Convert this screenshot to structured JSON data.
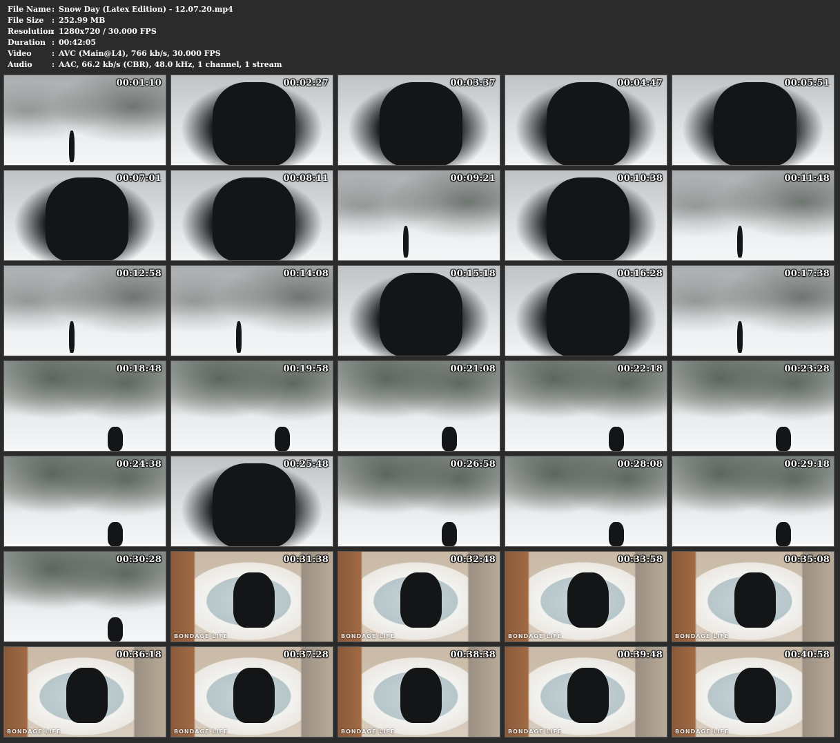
{
  "info": [
    {
      "key": "File Name",
      "sep": ":",
      "value": "Snow Day (Latex Edition) - 12.07.20.mp4"
    },
    {
      "key": "File Size",
      "sep": ":",
      "value": "252.99 MB"
    },
    {
      "key": "Resolution",
      "sep": ":",
      "value": "1280x720 / 30.000 FPS"
    },
    {
      "key": "Duration",
      "sep": ":",
      "value": "00:42:05"
    },
    {
      "key": "Video",
      "sep": ":",
      "value": "AVC (Main@L4), 766 kb/s, 30.000 FPS"
    },
    {
      "key": "Audio",
      "sep": ":",
      "value": "AAC, 66.2 kb/s (CBR), 48.0 kHz, 1 channel, 1 stream"
    }
  ],
  "thumbnails": [
    {
      "time": "00:01:10",
      "scene": "snow"
    },
    {
      "time": "00:02:27",
      "scene": "close"
    },
    {
      "time": "00:03:37",
      "scene": "close"
    },
    {
      "time": "00:04:47",
      "scene": "close"
    },
    {
      "time": "00:05:51",
      "scene": "close"
    },
    {
      "time": "00:07:01",
      "scene": "close"
    },
    {
      "time": "00:08:11",
      "scene": "close"
    },
    {
      "time": "00:09:21",
      "scene": "snow"
    },
    {
      "time": "00:10:38",
      "scene": "close"
    },
    {
      "time": "00:11:48",
      "scene": "snow"
    },
    {
      "time": "00:12:58",
      "scene": "snow"
    },
    {
      "time": "00:14:08",
      "scene": "snow"
    },
    {
      "time": "00:15:18",
      "scene": "close"
    },
    {
      "time": "00:16:28",
      "scene": "close"
    },
    {
      "time": "00:17:38",
      "scene": "snow"
    },
    {
      "time": "00:18:48",
      "scene": "tree"
    },
    {
      "time": "00:19:58",
      "scene": "tree"
    },
    {
      "time": "00:21:08",
      "scene": "tree"
    },
    {
      "time": "00:22:18",
      "scene": "tree"
    },
    {
      "time": "00:23:28",
      "scene": "tree"
    },
    {
      "time": "00:24:38",
      "scene": "tree"
    },
    {
      "time": "00:25:48",
      "scene": "close"
    },
    {
      "time": "00:26:58",
      "scene": "tree"
    },
    {
      "time": "00:28:08",
      "scene": "tree"
    },
    {
      "time": "00:29:18",
      "scene": "tree"
    },
    {
      "time": "00:30:28",
      "scene": "tree"
    },
    {
      "time": "00:31:38",
      "scene": "bath",
      "watermark": "BONDAGE LIFE"
    },
    {
      "time": "00:32:48",
      "scene": "bath",
      "watermark": "BONDAGE LIFE"
    },
    {
      "time": "00:33:58",
      "scene": "bath",
      "watermark": "BONDAGE LIFE"
    },
    {
      "time": "00:35:08",
      "scene": "bath",
      "watermark": "BONDAGE LIFE"
    },
    {
      "time": "00:36:18",
      "scene": "bath",
      "watermark": "BONDAGE LIFE"
    },
    {
      "time": "00:37:28",
      "scene": "bath",
      "watermark": "BONDAGE LIFE"
    },
    {
      "time": "00:38:38",
      "scene": "bath",
      "watermark": "BONDAGE LIFE"
    },
    {
      "time": "00:39:48",
      "scene": "bath",
      "watermark": "BONDAGE LIFE"
    },
    {
      "time": "00:40:58",
      "scene": "bath",
      "watermark": "BONDAGE LIFE"
    }
  ]
}
